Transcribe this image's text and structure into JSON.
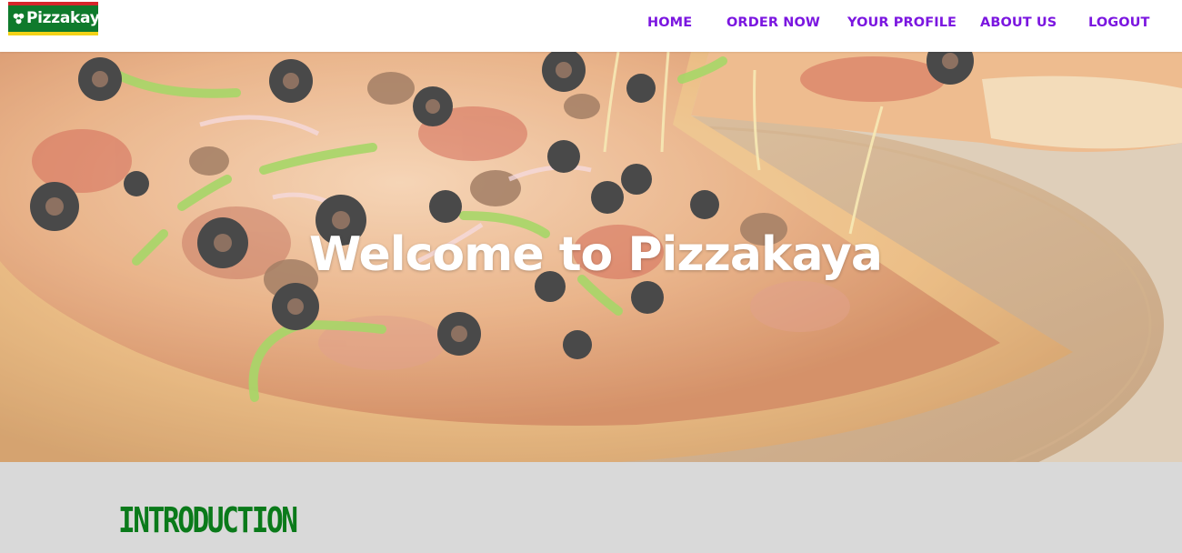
{
  "brand": {
    "name": "Pizzakaya",
    "logo_icon": "pizza-leaf-icon"
  },
  "nav": {
    "items": [
      {
        "label": "HOME"
      },
      {
        "label": "ORDER NOW"
      },
      {
        "label": "YOUR PROFILE"
      },
      {
        "label": "ABOUT US"
      },
      {
        "label": "LOGOUT"
      }
    ]
  },
  "hero": {
    "title": "Welcome to Pizzakaya"
  },
  "intro": {
    "heading": "INTRODUCTION"
  },
  "colors": {
    "nav_link": "#7b16e0",
    "logo_green": "#0f7a2c",
    "logo_red": "#d6262b",
    "logo_yellow": "#f3d217",
    "intro_heading": "#0a7a1a",
    "intro_background": "#d9d9d9"
  }
}
